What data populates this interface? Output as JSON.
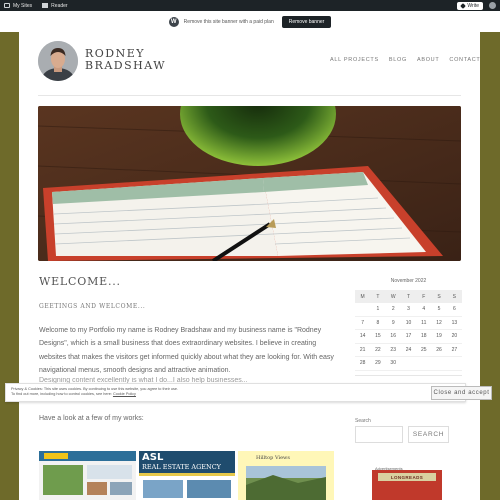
{
  "admin_bar": {
    "my_sites": "My Sites",
    "reader": "Reader",
    "write": "Write"
  },
  "banner": {
    "text": "Remove this site banner with a paid plan",
    "button": "Remove banner"
  },
  "site": {
    "title": "RODNEY BRADSHAW"
  },
  "nav": {
    "items": [
      "ALL PROJECTS",
      "BLOG",
      "ABOUT",
      "CONTACT"
    ]
  },
  "content": {
    "title": "WELCOME...",
    "subtitle": "GEETINGS AND WELCOME...",
    "paragraph": "Welcome to my Portfolio my name is Rodney Bradshaw and my business name is \"Rodney Designs\", which is a small business that does extraordinary websites. I believe in creating websites that makes the visitors get informed quickly about what they are looking for. With easy navigational menus, smooth designs and attractive animation.",
    "paragraph_2": "Designing content excellently is what I do...I also help businesses...",
    "works_heading": "Have a look at a few of my works:"
  },
  "calendar": {
    "caption": "November 2022",
    "days": [
      "M",
      "T",
      "W",
      "T",
      "F",
      "S",
      "S"
    ],
    "weeks": [
      [
        "",
        "1",
        "2",
        "3",
        "4",
        "5",
        "6"
      ],
      [
        "7",
        "8",
        "9",
        "10",
        "11",
        "12",
        "13"
      ],
      [
        "14",
        "15",
        "16",
        "17",
        "18",
        "19",
        "20"
      ],
      [
        "21",
        "22",
        "23",
        "24",
        "25",
        "26",
        "27"
      ],
      [
        "28",
        "29",
        "30",
        "",
        "",
        "",
        ""
      ]
    ]
  },
  "search": {
    "label": "Search",
    "button": "SEARCH"
  },
  "advertisement": {
    "label": "Advertisements",
    "longreads": "LONGREADS"
  },
  "thumbs": {
    "asl_title": "ASL",
    "asl_sub": "REAL ESTATE AGENCY",
    "third_title": "Hilltop Views"
  },
  "cookie": {
    "line1": "Privacy & Cookies: This site uses cookies. By continuing to use this website, you agree to their use.",
    "line2": "To find out more, including how to control cookies, see here: ",
    "link": "Cookie Policy",
    "button": "Close and accept"
  }
}
